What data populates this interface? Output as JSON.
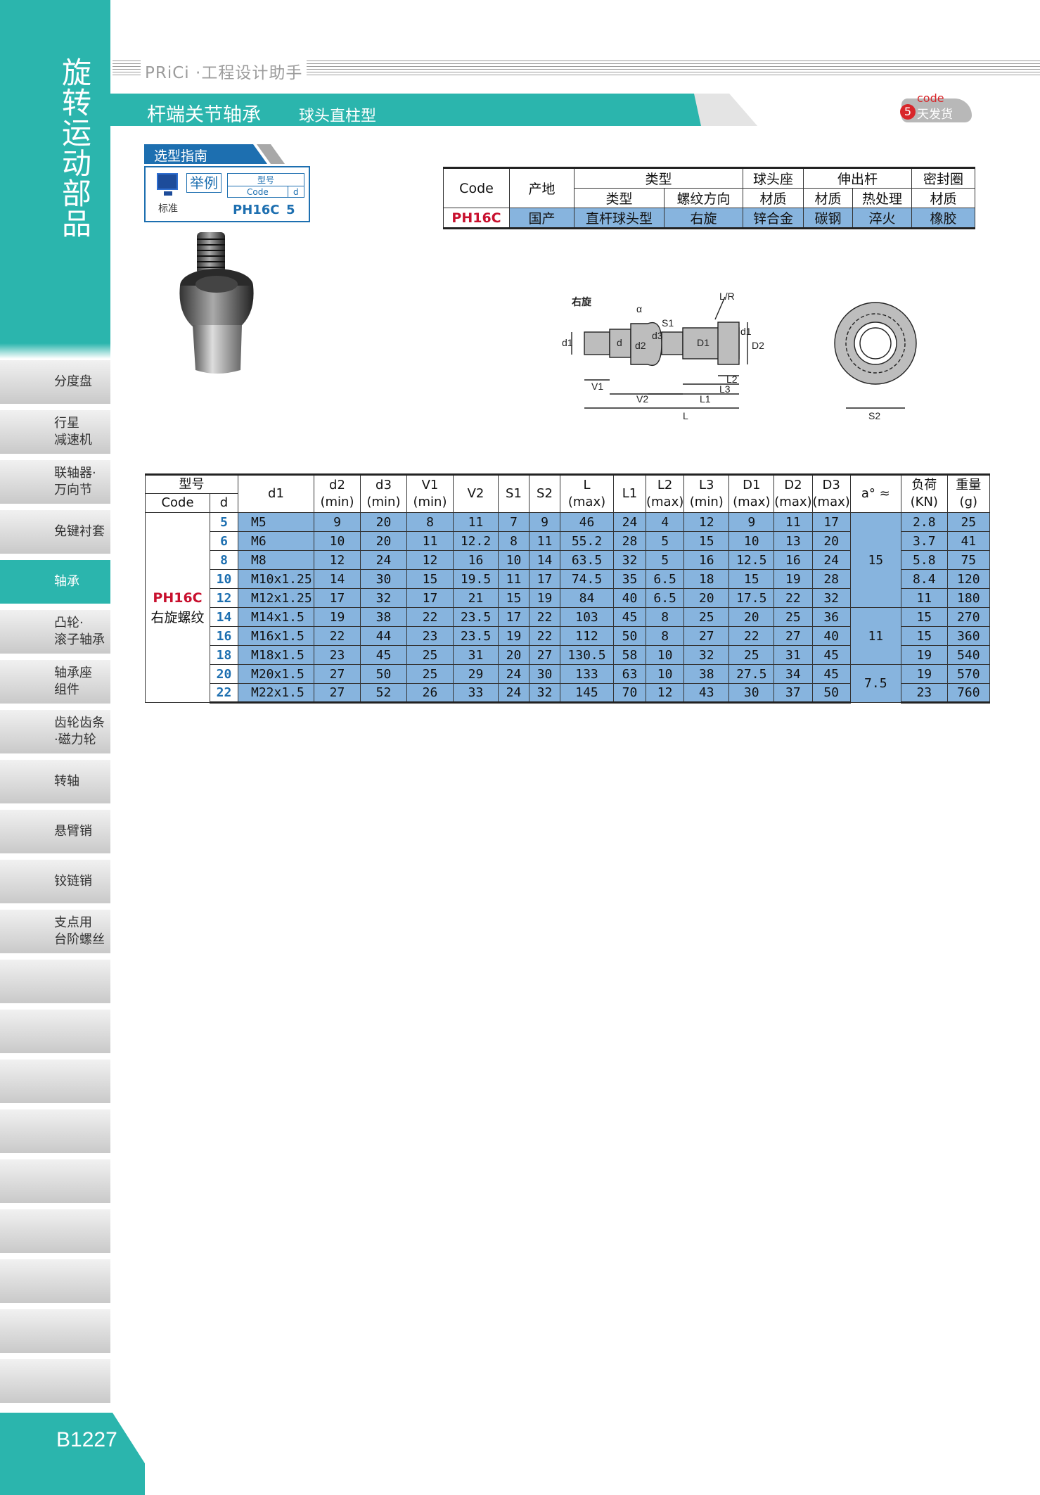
{
  "sidebar": {
    "section_title": "旋转运动部品",
    "tabs": [
      {
        "l1": "分度盘",
        "l2": ""
      },
      {
        "l1": "行星",
        "l2": "减速机"
      },
      {
        "l1": "联轴器·",
        "l2": "万向节"
      },
      {
        "l1": "免键衬套",
        "l2": ""
      },
      {
        "l1": "轴承",
        "l2": ""
      },
      {
        "l1": "凸轮·",
        "l2": "滚子轴承"
      },
      {
        "l1": "轴承座",
        "l2": "组件"
      },
      {
        "l1": "齿轮齿条",
        "l2": "·磁力轮"
      },
      {
        "l1": "转轴",
        "l2": ""
      },
      {
        "l1": "悬臂销",
        "l2": ""
      },
      {
        "l1": "铰链销",
        "l2": ""
      },
      {
        "l1": "支点用",
        "l2": "台阶螺丝"
      }
    ],
    "active_tab": "轴承",
    "page_number": "B1227"
  },
  "header": {
    "brand": "PRiCi ·工程设计助手",
    "title": "杆端关节轴承",
    "subtitle": "球头直柱型",
    "badge_code": "code",
    "badge_num": "5",
    "badge_text": "天发货"
  },
  "guide": {
    "title": "选型指南",
    "example": "举例",
    "standard": "标准",
    "col_model": "型号",
    "col_code": "Code",
    "col_d": "d",
    "ex_code": "PH16C",
    "ex_d": "5"
  },
  "spec": {
    "h_code": "Code",
    "h_origin": "产地",
    "h_type": "类型",
    "h_ball": "球头座",
    "h_rod": "伸出杆",
    "h_seal": "密封圈",
    "sub_type": "类型",
    "sub_thread": "螺纹方向",
    "sub_mat1": "材质",
    "sub_mat2": "材质",
    "sub_heat": "热处理",
    "sub_mat3": "材质",
    "row": [
      "PH16C",
      "国产",
      "直杆球头型",
      "右旋",
      "锌合金",
      "碳钢",
      "淬火",
      "橡胶"
    ]
  },
  "drawing": {
    "label_right": "右旋",
    "dims": [
      "d1",
      "d2",
      "d",
      "d3",
      "D1",
      "D2",
      "d1",
      "V1",
      "V2",
      "L1",
      "L3",
      "L2",
      "L",
      "L/R",
      "S1",
      "α",
      "S2"
    ]
  },
  "table": {
    "h_model": "型号",
    "h_code": "Code",
    "h_d": "d",
    "h_d1": "d1",
    "h_d2": "d2",
    "h_d3": "d3",
    "h_v1": "V1",
    "h_v2": "V2",
    "h_s1": "S1",
    "h_s2": "S2",
    "h_l": "L",
    "h_l1": "L1",
    "h_l2": "L2",
    "h_l3": "L3",
    "h_dd1": "D1",
    "h_dd2": "D2",
    "h_dd3": "D3",
    "h_a": "a° ≈",
    "h_load": "负荷",
    "h_weight": "重量",
    "u_min": "(min)",
    "u_max": "(max)",
    "u_kn": "(KN)",
    "u_g": "(g)",
    "model_code": "PH16C",
    "model_desc": "右旋螺纹",
    "a_groups": [
      "15",
      "11",
      "7.5"
    ],
    "rows": [
      [
        "5",
        "M5",
        "9",
        "20",
        "8",
        "11",
        "7",
        "9",
        "46",
        "24",
        "4",
        "12",
        "9",
        "11",
        "17",
        "2.8",
        "25"
      ],
      [
        "6",
        "M6",
        "10",
        "20",
        "11",
        "12.2",
        "8",
        "11",
        "55.2",
        "28",
        "5",
        "15",
        "10",
        "13",
        "20",
        "3.7",
        "41"
      ],
      [
        "8",
        "M8",
        "12",
        "24",
        "12",
        "16",
        "10",
        "14",
        "63.5",
        "32",
        "5",
        "16",
        "12.5",
        "16",
        "24",
        "5.8",
        "75"
      ],
      [
        "10",
        "M10x1.25",
        "14",
        "30",
        "15",
        "19.5",
        "11",
        "17",
        "74.5",
        "35",
        "6.5",
        "18",
        "15",
        "19",
        "28",
        "8.4",
        "120"
      ],
      [
        "12",
        "M12x1.25",
        "17",
        "32",
        "17",
        "21",
        "15",
        "19",
        "84",
        "40",
        "6.5",
        "20",
        "17.5",
        "22",
        "32",
        "11",
        "180"
      ],
      [
        "14",
        "M14x1.5",
        "19",
        "38",
        "22",
        "23.5",
        "17",
        "22",
        "103",
        "45",
        "8",
        "25",
        "20",
        "25",
        "36",
        "15",
        "270"
      ],
      [
        "16",
        "M16x1.5",
        "22",
        "44",
        "23",
        "23.5",
        "19",
        "22",
        "112",
        "50",
        "8",
        "27",
        "22",
        "27",
        "40",
        "15",
        "360"
      ],
      [
        "18",
        "M18x1.5",
        "23",
        "45",
        "25",
        "31",
        "20",
        "27",
        "130.5",
        "58",
        "10",
        "32",
        "25",
        "31",
        "45",
        "19",
        "540"
      ],
      [
        "20",
        "M20x1.5",
        "27",
        "50",
        "25",
        "29",
        "24",
        "30",
        "133",
        "63",
        "10",
        "38",
        "27.5",
        "34",
        "45",
        "19",
        "570"
      ],
      [
        "22",
        "M22x1.5",
        "27",
        "52",
        "26",
        "33",
        "24",
        "32",
        "145",
        "70",
        "12",
        "43",
        "30",
        "37",
        "50",
        "23",
        "760"
      ]
    ]
  },
  "colors": {
    "teal": "#2bb5ad",
    "blue": "#87b4de",
    "red": "#c8102e"
  }
}
